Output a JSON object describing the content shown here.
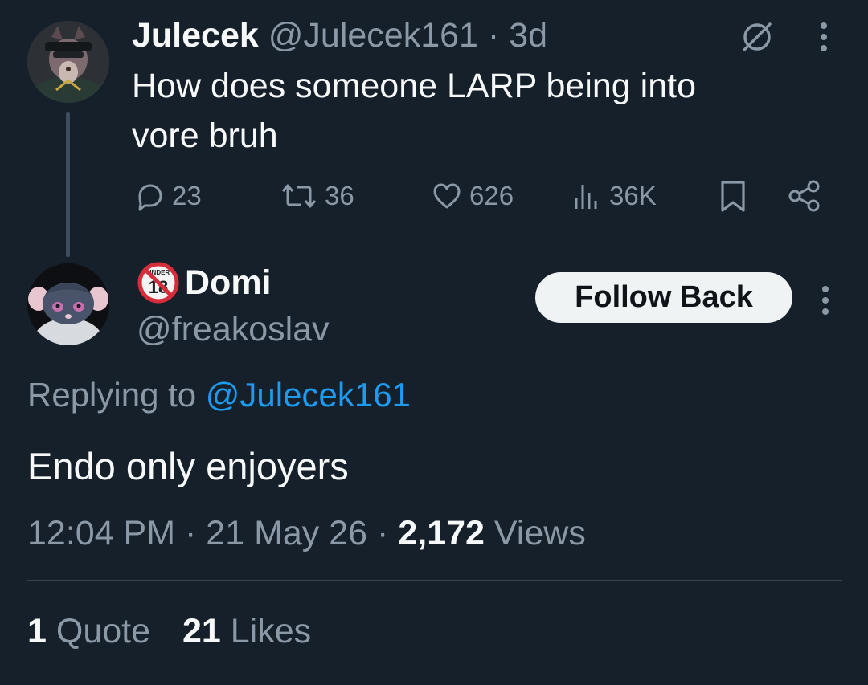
{
  "parent_tweet": {
    "display_name": "Julecek",
    "handle": "@Julecek161",
    "separator": "·",
    "time_ago": "3d",
    "text_line1": "How does someone LARP being into",
    "text_line2": "vore bruh",
    "actions": {
      "replies": "23",
      "retweets": "36",
      "likes": "626",
      "views": "36K"
    }
  },
  "reply_tweet": {
    "display_name": "Domi",
    "name_badge_icon": "under-18-icon",
    "badge_text": "UNDER",
    "badge_number": "18",
    "handle": "@freakoslav",
    "follow_button_label": "Follow Back",
    "replying_prefix": "Replying to",
    "replying_to": "@Julecek161",
    "text": "Endo only enjoyers",
    "time": "12:04 PM",
    "date": "21 May 26",
    "views_count": "2,172",
    "views_label": "Views",
    "quotes_count": "1",
    "quotes_label": "Quote",
    "likes_count": "21",
    "likes_label": "Likes"
  },
  "colors": {
    "background": "#15202b",
    "text_primary": "#f7f9f9",
    "text_secondary": "#8b98a5",
    "link": "#1d9bf0",
    "divider": "#38444d",
    "button_bg": "#eff3f4"
  }
}
